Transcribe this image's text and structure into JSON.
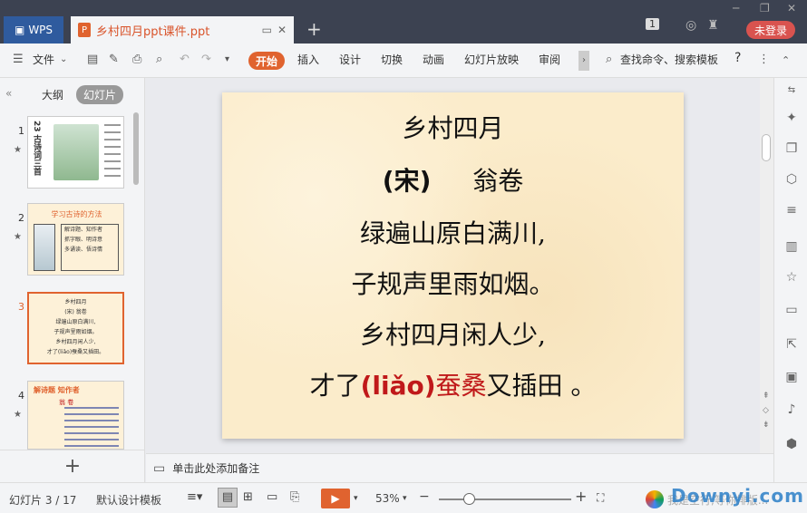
{
  "titlebar": {
    "wps_label": "WPS",
    "doc_tab_title": "乡村四月ppt课件.ppt",
    "new_tab_symbol": "+",
    "badge_number": "1",
    "login_label": "未登录"
  },
  "toolbar": {
    "file_label": "文件",
    "start_label": "开始",
    "tabs": [
      "插入",
      "设计",
      "切换",
      "动画",
      "幻灯片放映",
      "审阅"
    ],
    "search_label": "查找命令、搜索模板",
    "help_symbol": "?"
  },
  "left_panel": {
    "tab_outline": "大纲",
    "tab_slides": "幻灯片",
    "thumbs": [
      {
        "num": "1",
        "title_text": "23 古诗词三首"
      },
      {
        "num": "2",
        "title_text": "学习古诗的方法",
        "items": [
          "解诗题、知作者",
          "抓字眼、明诗意",
          "多诵读、悟诗情"
        ]
      },
      {
        "num": "3",
        "lines": [
          "乡村四月",
          "(宋)  翁卷",
          "绿遍山原白满川,",
          "子规声里雨如烟。",
          "乡村四月闲人少,",
          "才了(liǎo)蚕桑又插田。"
        ]
      },
      {
        "num": "4",
        "title_text": "解诗题 知作者",
        "sub": "翁 卷"
      }
    ],
    "add_symbol": "+"
  },
  "slide": {
    "title": "乡村四月",
    "dynasty": "(宋)",
    "author": "翁卷",
    "line1": "绿遍山原白满川,",
    "line2": "子规声里雨如烟。",
    "line3": "乡村四月闲人少,",
    "line4_pre": "才了",
    "line4_pinyin": "(liǎo)",
    "line4_red": "蚕桑",
    "line4_post": "又插田 。"
  },
  "notes": {
    "placeholder": "单击此处添加备注"
  },
  "statusbar": {
    "slide_counter": "幻灯片 3 / 17",
    "template_label": "默认设计模板",
    "zoom_value": "53%",
    "zoom_level": 0.2,
    "watermark_text": "我是空行,等你排版...",
    "watermark_brand": "Downyi.com"
  },
  "colors": {
    "accent": "#e0632f",
    "title_bar": "#3c4251",
    "slide_bg": "#fbeccb",
    "highlight_red": "#c0191a"
  }
}
